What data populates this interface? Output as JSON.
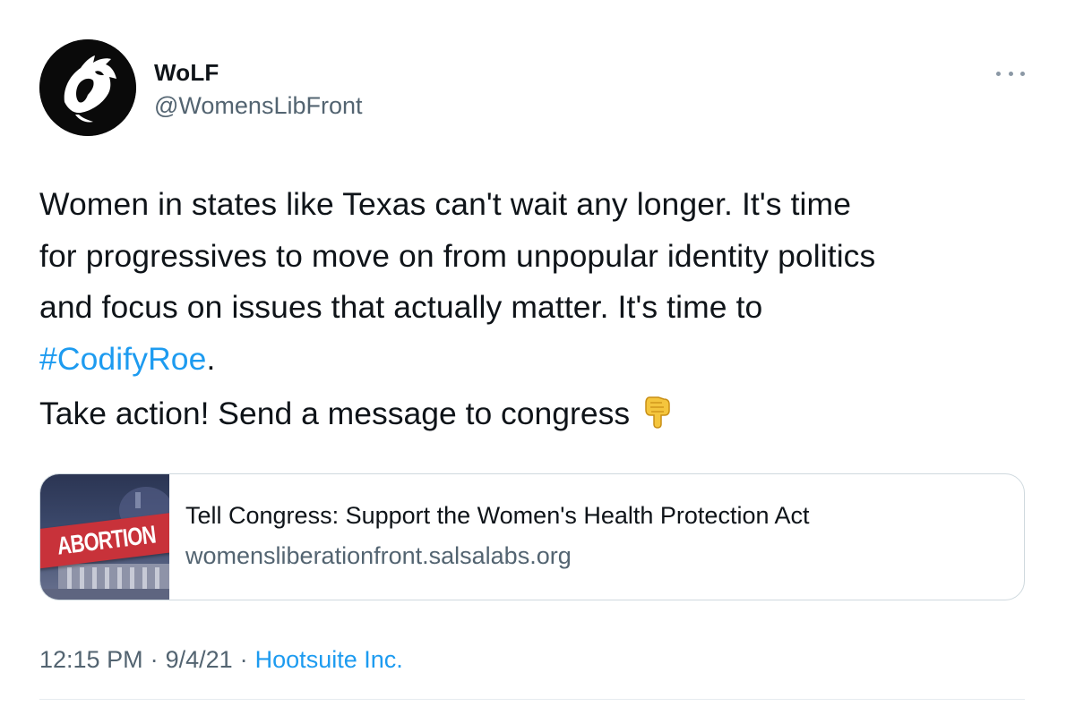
{
  "author": {
    "name": "WoLF",
    "handle": "@WomensLibFront",
    "avatar_icon": "wolf-logo-icon"
  },
  "more_icon": "more-dots-icon",
  "tweet": {
    "lines": [
      "Women in states like Texas can't wait any longer. It's time",
      "for progressives to move on from unpopular identity politics",
      "and focus on issues that actually matter. It's time to"
    ],
    "hashtag": "#CodifyRoe",
    "hashtag_suffix": ".",
    "action": "Take action! Send a message to congress",
    "emoji_icon": "backhand-index-pointing-down-icon"
  },
  "card": {
    "thumb_label": "ABORTION",
    "title": "Tell Congress: Support the Women's Health Protection Act",
    "domain": "womensliberationfront.salsalabs.org"
  },
  "meta": {
    "time": "12:15 PM",
    "date": "9/4/21",
    "separator": "·",
    "source": "Hootsuite Inc."
  },
  "colors": {
    "link": "#1d9bf0",
    "secondary_text": "#536471",
    "primary_text": "#0f1419",
    "card_border": "#cfd9de",
    "banner_red": "#c8323a"
  }
}
